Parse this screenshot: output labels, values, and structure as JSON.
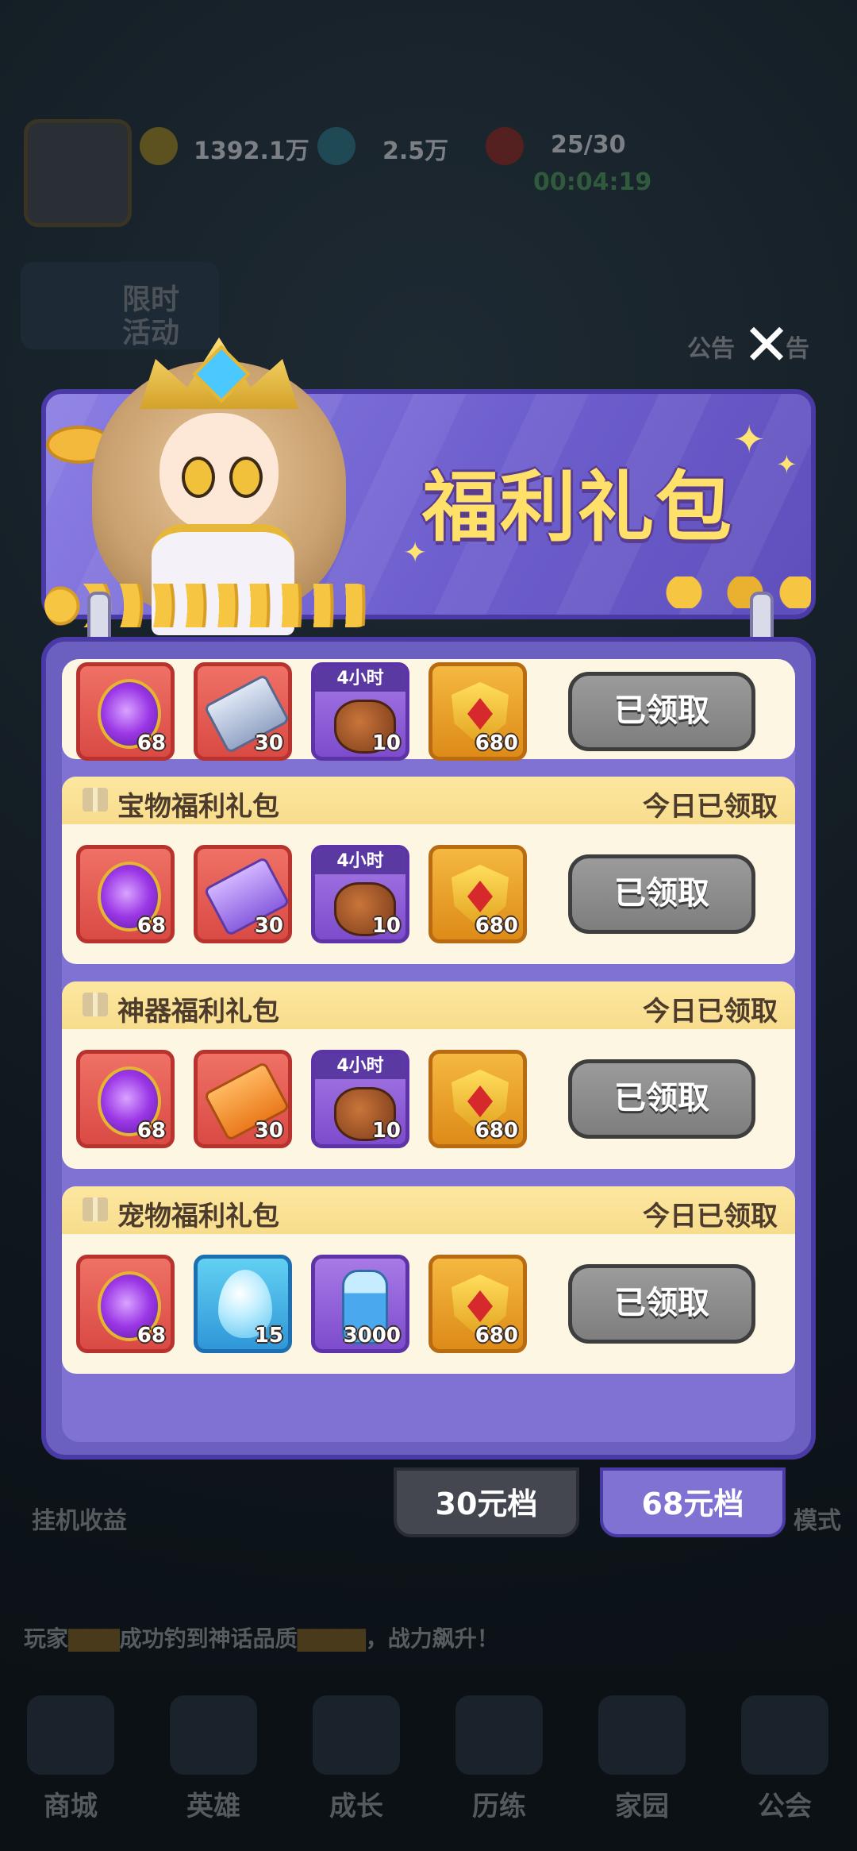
{
  "status_bar": {
    "gold": "1392.1万",
    "gems": "2.5万",
    "stamina": "25/30",
    "timer": "00:04:19"
  },
  "background": {
    "event_tag": "限时活动",
    "notice_left": "公告",
    "notice_right": "告",
    "side_idle": "挂机收益",
    "side_mode": "模式",
    "ticker_prefix": "玩家",
    "ticker_middle": "成功钓到神话品质",
    "ticker_suffix": "，战力飙升！"
  },
  "bottom_nav": [
    "商城",
    "英雄",
    "成长",
    "历练",
    "家园",
    "公会"
  ],
  "modal": {
    "title": "福利礼包",
    "close_icon": "close-icon",
    "packs": [
      {
        "name": "",
        "status": "",
        "items": [
          {
            "icon": "purple-orb",
            "qty": "68",
            "tag": ""
          },
          {
            "icon": "silver-ticket",
            "qty": "30",
            "tag": ""
          },
          {
            "icon": "gold-bag",
            "qty": "10",
            "tag": "4小时"
          },
          {
            "icon": "red-shield",
            "qty": "680",
            "tag": ""
          }
        ],
        "button": "已领取"
      },
      {
        "name": "宝物福利礼包",
        "status": "今日已领取",
        "items": [
          {
            "icon": "purple-orb",
            "qty": "68",
            "tag": ""
          },
          {
            "icon": "violet-ticket",
            "qty": "30",
            "tag": ""
          },
          {
            "icon": "gold-bag",
            "qty": "10",
            "tag": "4小时"
          },
          {
            "icon": "red-shield",
            "qty": "680",
            "tag": ""
          }
        ],
        "button": "已领取"
      },
      {
        "name": "神器福利礼包",
        "status": "今日已领取",
        "items": [
          {
            "icon": "purple-orb",
            "qty": "68",
            "tag": ""
          },
          {
            "icon": "orange-ticket",
            "qty": "30",
            "tag": ""
          },
          {
            "icon": "gold-bag",
            "qty": "10",
            "tag": "4小时"
          },
          {
            "icon": "red-shield",
            "qty": "680",
            "tag": ""
          }
        ],
        "button": "已领取"
      },
      {
        "name": "宠物福利礼包",
        "status": "今日已领取",
        "items": [
          {
            "icon": "purple-orb",
            "qty": "68",
            "tag": ""
          },
          {
            "icon": "pet-egg",
            "qty": "15",
            "tag": ""
          },
          {
            "icon": "potion-bottle",
            "qty": "3000",
            "tag": ""
          },
          {
            "icon": "red-shield",
            "qty": "680",
            "tag": ""
          }
        ],
        "button": "已领取"
      }
    ],
    "tabs": [
      {
        "label": "30元档",
        "active": false
      },
      {
        "label": "68元档",
        "active": true
      }
    ]
  },
  "colors": {
    "panel": "#6b5fbf",
    "title": "#ffe16a",
    "card": "#fdf6e2",
    "claimed_button": "#8c8c8c"
  }
}
